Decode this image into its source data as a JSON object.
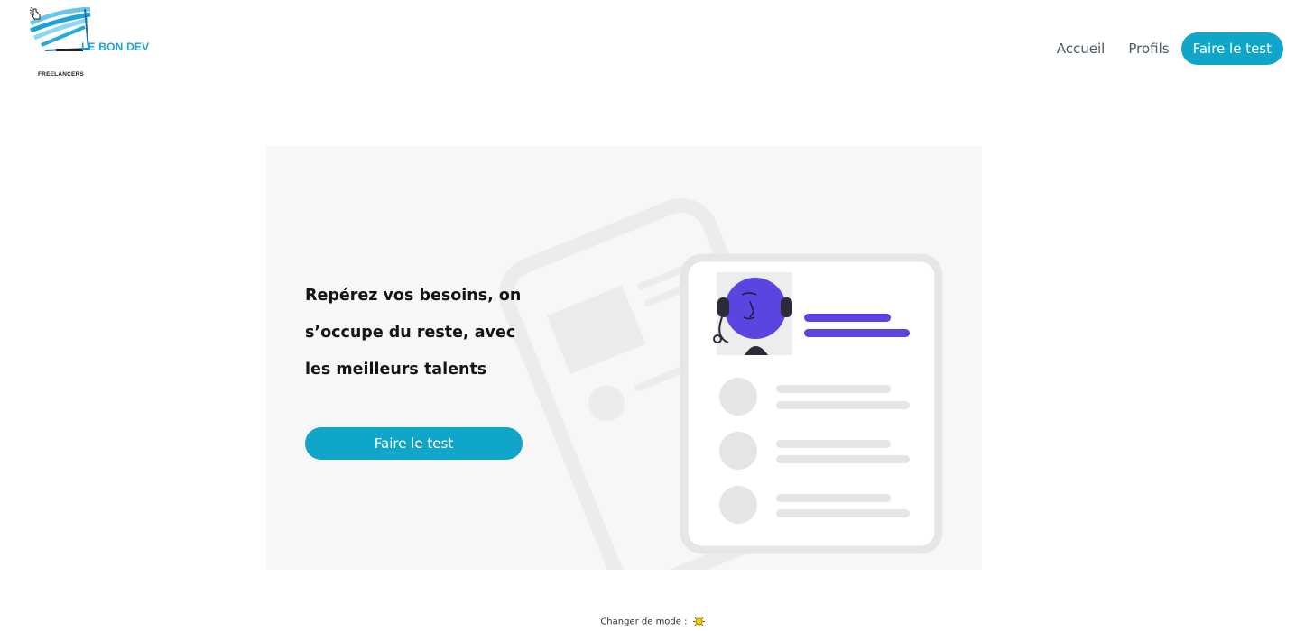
{
  "brand": {
    "name": "LE BON DEV",
    "tagline": "FREELANCERS"
  },
  "nav": {
    "items": [
      {
        "label": "Accueil"
      },
      {
        "label": "Profils"
      }
    ],
    "cta_label": "Faire le test"
  },
  "hero": {
    "headline_lines": [
      "Repérez vos besoins, on",
      "s’occupe du reste, avec",
      "les meilleurs talents"
    ],
    "cta_label": "Faire le test",
    "illustration": "support-agent-profile-card"
  },
  "footer": {
    "mode_label": "Changer de mode :",
    "mode_icon": "sun-icon"
  },
  "colors": {
    "accent": "#0fa6c9",
    "purple": "#5a45e0",
    "hero_bg": "#f7f7f8"
  }
}
